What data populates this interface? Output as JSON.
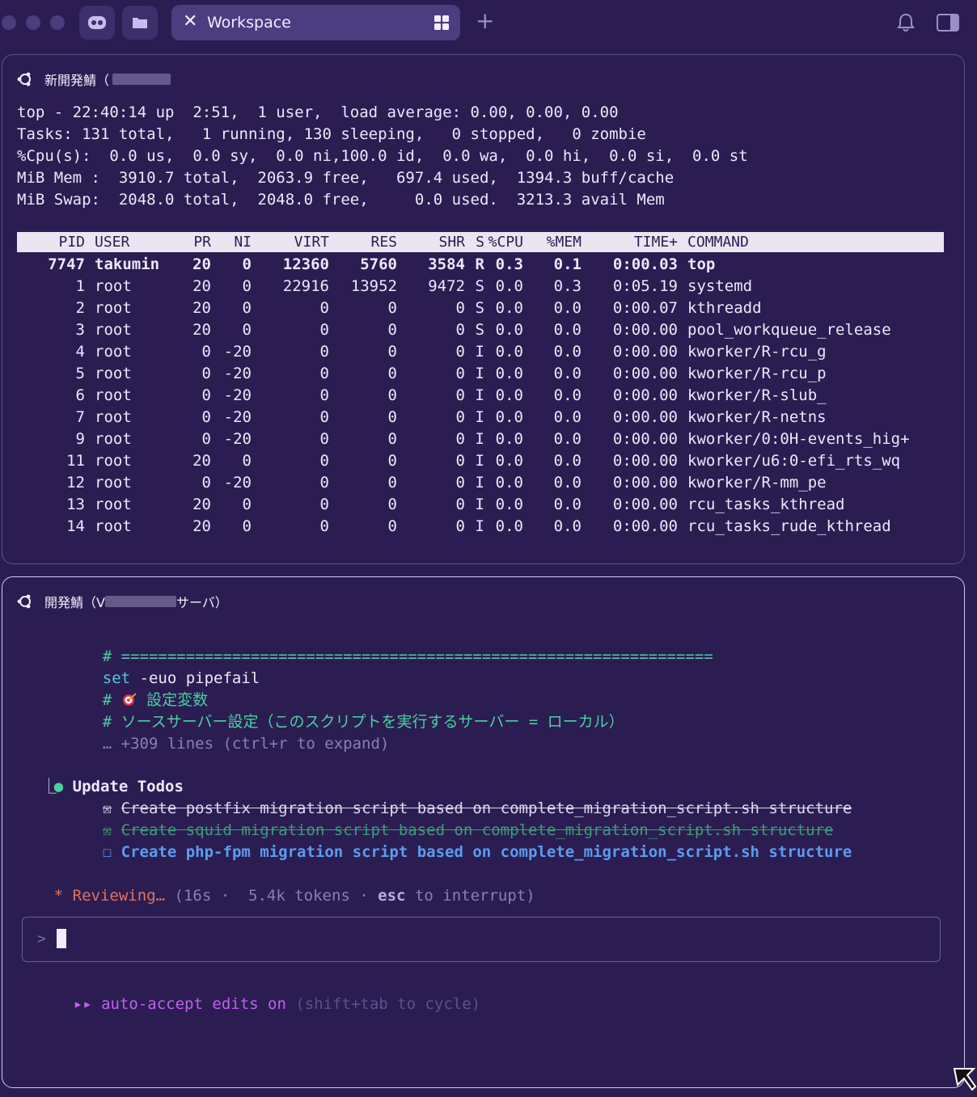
{
  "tabbar": {
    "tab_title": "Workspace",
    "add_tab": "+"
  },
  "pane1": {
    "title": "新開発鯖（",
    "summary": [
      "top - 22:40:14 up  2:51,  1 user,  load average: 0.00, 0.00, 0.00",
      "Tasks: 131 total,   1 running, 130 sleeping,   0 stopped,   0 zombie",
      "%Cpu(s):  0.0 us,  0.0 sy,  0.0 ni,100.0 id,  0.0 wa,  0.0 hi,  0.0 si,  0.0 st",
      "MiB Mem :  3910.7 total,  2063.9 free,   697.4 used,  1394.3 buff/cache",
      "MiB Swap:  2048.0 total,  2048.0 free,     0.0 used.  3213.3 avail Mem"
    ],
    "columns": [
      "PID",
      "USER",
      "PR",
      "NI",
      "VIRT",
      "RES",
      "SHR",
      "S",
      "%CPU",
      "%MEM",
      "TIME+",
      "COMMAND"
    ],
    "processes": [
      [
        "7747",
        "takumin",
        "20",
        "0",
        "12360",
        "5760",
        "3584",
        "R",
        "0.3",
        "0.1",
        "0:00.03",
        "top"
      ],
      [
        "1",
        "root",
        "20",
        "0",
        "22916",
        "13952",
        "9472",
        "S",
        "0.0",
        "0.3",
        "0:05.19",
        "systemd"
      ],
      [
        "2",
        "root",
        "20",
        "0",
        "0",
        "0",
        "0",
        "S",
        "0.0",
        "0.0",
        "0:00.07",
        "kthreadd"
      ],
      [
        "3",
        "root",
        "20",
        "0",
        "0",
        "0",
        "0",
        "S",
        "0.0",
        "0.0",
        "0:00.00",
        "pool_workqueue_release"
      ],
      [
        "4",
        "root",
        "0",
        "-20",
        "0",
        "0",
        "0",
        "I",
        "0.0",
        "0.0",
        "0:00.00",
        "kworker/R-rcu_g"
      ],
      [
        "5",
        "root",
        "0",
        "-20",
        "0",
        "0",
        "0",
        "I",
        "0.0",
        "0.0",
        "0:00.00",
        "kworker/R-rcu_p"
      ],
      [
        "6",
        "root",
        "0",
        "-20",
        "0",
        "0",
        "0",
        "I",
        "0.0",
        "0.0",
        "0:00.00",
        "kworker/R-slub_"
      ],
      [
        "7",
        "root",
        "0",
        "-20",
        "0",
        "0",
        "0",
        "I",
        "0.0",
        "0.0",
        "0:00.00",
        "kworker/R-netns"
      ],
      [
        "9",
        "root",
        "0",
        "-20",
        "0",
        "0",
        "0",
        "I",
        "0.0",
        "0.0",
        "0:00.00",
        "kworker/0:0H-events_hig+"
      ],
      [
        "11",
        "root",
        "20",
        "0",
        "0",
        "0",
        "0",
        "I",
        "0.0",
        "0.0",
        "0:00.00",
        "kworker/u6:0-efi_rts_wq"
      ],
      [
        "12",
        "root",
        "0",
        "-20",
        "0",
        "0",
        "0",
        "I",
        "0.0",
        "0.0",
        "0:00.00",
        "kworker/R-mm_pe"
      ],
      [
        "13",
        "root",
        "20",
        "0",
        "0",
        "0",
        "0",
        "I",
        "0.0",
        "0.0",
        "0:00.00",
        "rcu_tasks_kthread"
      ],
      [
        "14",
        "root",
        "20",
        "0",
        "0",
        "0",
        "0",
        "I",
        "0.0",
        "0.0",
        "0:00.00",
        "rcu_tasks_rude_kthread"
      ]
    ]
  },
  "pane2": {
    "title_prefix": "開発鯖（V",
    "title_suffix": "サーバ）",
    "code": {
      "line1": "# ================================================================",
      "line2_kw": "set",
      "line2_rest": " -euo pipefail",
      "line3_hash": "# ",
      "line3_text": " 設定変数",
      "line4": "# ソースサーバー設定（このスクリプトを実行するサーバー = ローカル）",
      "line5": "… +309 lines (ctrl+r to expand)"
    },
    "todos": {
      "header": "Update Todos",
      "items": [
        {
          "mark": "☒",
          "text": "Create postfix migration script based on complete_migration_script.sh structure",
          "state": "done"
        },
        {
          "mark": "☒",
          "text": "Create squid migration script based on complete_migration_script.sh structure",
          "state": "done"
        },
        {
          "mark": "☐",
          "text": "Create php-fpm migration script based on complete_migration_script.sh structure",
          "state": "active"
        }
      ]
    },
    "status": {
      "star": "*",
      "label": "Reviewing…",
      "open": " (16s ·  5.4k tokens · ",
      "key": "esc",
      "close": " to interrupt)"
    },
    "prompt_symbol": ">",
    "mode": {
      "arrows": "▸▸",
      "label": "auto-accept edits on",
      "hint": "(shift+tab to cycle)"
    }
  },
  "colors": {
    "background": "#2b1d52",
    "accent_green": "#4ad0a0",
    "accent_blue": "#5a9cf0",
    "accent_orange": "#e0735e",
    "accent_purple": "#c060f0"
  }
}
